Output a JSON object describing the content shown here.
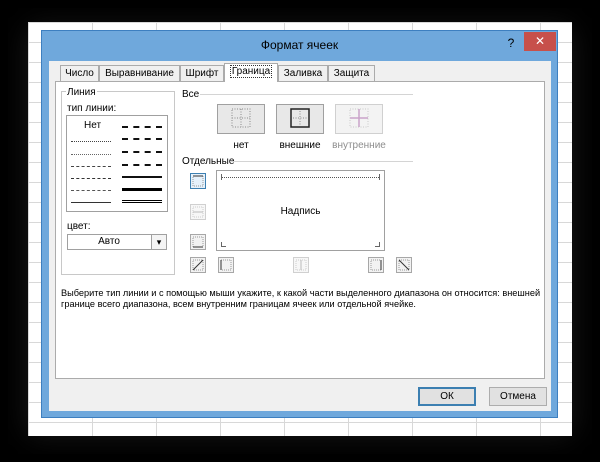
{
  "dialog": {
    "title": "Формат ячеек",
    "help_label": "?",
    "close_label": "✕"
  },
  "tabs": [
    {
      "label": "Число"
    },
    {
      "label": "Выравнивание"
    },
    {
      "label": "Шрифт"
    },
    {
      "label": "Граница",
      "active": true
    },
    {
      "label": "Заливка"
    },
    {
      "label": "Защита"
    }
  ],
  "line": {
    "group_label": "Линия",
    "type_label": "тип линии:",
    "none_label": "Нет",
    "color_label": "цвет:",
    "color_value": "Авто"
  },
  "presets": {
    "group_label": "Все",
    "items": [
      {
        "label": "нет"
      },
      {
        "label": "внешние"
      },
      {
        "label": "внутренние",
        "disabled": true
      }
    ]
  },
  "border": {
    "group_label": "Отдельные",
    "preview_text": "Надпись"
  },
  "description": "Выберите тип линии и с помощью мыши укажите, к какой части выделенного диапазона он относится: внешней границе всего диапазона, всем внутренним границам ячеек или отдельной ячейке.",
  "buttons": {
    "ok": "ОК",
    "cancel": "Отмена"
  },
  "colors": {
    "titlebar": "#6fa8dc",
    "close": "#c7504b",
    "accent": "#3c7fb1"
  }
}
